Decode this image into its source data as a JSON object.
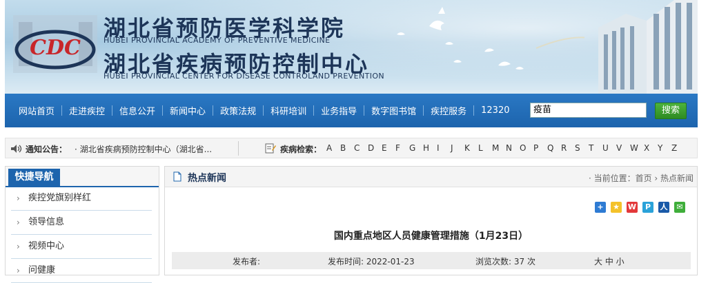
{
  "header": {
    "title_cn_1": "湖北省预防医学科学院",
    "title_en_1": "HUBEI PROVINCIAL ACADEMY OF PREVENTIVE MEDICINE",
    "title_cn_2": "湖北省疾病预防控制中心",
    "title_en_2": "HUBEI PROVINCIAL CENTER FOR DISEASE CONTROLAND PREVENTION"
  },
  "nav": {
    "items": [
      "网站首页",
      "走进疾控",
      "信息公开",
      "新闻中心",
      "政策法规",
      "科研培训",
      "业务指导",
      "数字图书馆",
      "疾控服务",
      "12320"
    ],
    "search_value": "疫苗",
    "search_button": "搜索"
  },
  "notice": {
    "label": "通知公告：",
    "text": "· 湖北省疾病预防控制中心（湖北省...",
    "disease_label": "疾病检索：",
    "letters": [
      "A",
      "B",
      "C",
      "D",
      "E",
      "F",
      "G",
      "H",
      "I",
      "J",
      "K",
      "L",
      "M",
      "N",
      "O",
      "P",
      "Q",
      "R",
      "S",
      "T",
      "U",
      "V",
      "W",
      "X",
      "Y",
      "Z"
    ]
  },
  "sidebar": {
    "title": "快捷导航",
    "items": [
      "疾控党旗别样红",
      "领导信息",
      "视频中心",
      "问健康"
    ]
  },
  "main": {
    "section_title": "热点新闻",
    "breadcrumb": "· 当前位置：首页 › 热点新闻",
    "article_title": "国内重点地区人员健康管理措施（1月23日）",
    "meta": {
      "publisher": "发布者:",
      "date": "发布时间: 2022-01-23",
      "views": "浏览次数: 37 次",
      "font_size": "大 中 小"
    }
  },
  "colors": {
    "nav_blue": "#1d64ad",
    "title_navy": "#1d3558",
    "search_green": "#3ea32f"
  }
}
